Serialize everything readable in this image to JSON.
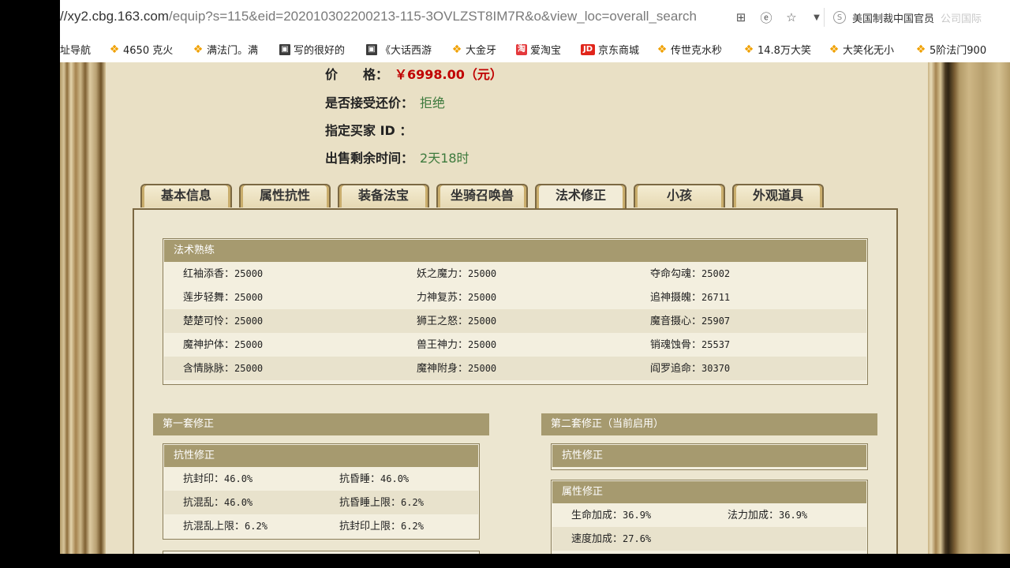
{
  "browser": {
    "url_host": "//xy2.cbg.163.com",
    "url_path": "/equip?s=115&eid=202010302200213-115-3OVLZST8IM7R&o&view_loc=overall_search",
    "icons": [
      "grid-icon",
      "ie-icon",
      "star-icon",
      "dropdown-icon"
    ],
    "search_engine_icon": "S",
    "search_text": "美国制裁中国官员",
    "search_ghost": "公司国际"
  },
  "bookmarks": [
    {
      "label": "址导航",
      "icon": "none"
    },
    {
      "label": "4650 克火",
      "icon": "star"
    },
    {
      "label": "满法门。满",
      "icon": "star"
    },
    {
      "label": "写的很好的",
      "icon": "img"
    },
    {
      "label": "《大话西游",
      "icon": "img"
    },
    {
      "label": "大金牙",
      "icon": "star"
    },
    {
      "label": "爱淘宝",
      "icon": "tao"
    },
    {
      "label": "京东商城",
      "icon": "jd"
    },
    {
      "label": "传世克水秒",
      "icon": "star"
    },
    {
      "label": "14.8万大笑",
      "icon": "star"
    },
    {
      "label": "大笑化无小",
      "icon": "star"
    },
    {
      "label": "5阶法门900",
      "icon": "star"
    }
  ],
  "info": {
    "price_label": "价　　格：",
    "price_value": "￥6998.00（元）",
    "counter_label": "是否接受还价：",
    "counter_value": "拒绝",
    "buyer_label": "指定买家 ID ：",
    "buyer_value": "",
    "time_label": "出售剩余时间：",
    "time_value": "2天18时"
  },
  "tabs": [
    "基本信息",
    "属性抗性",
    "装备法宝",
    "坐骑召唤兽",
    "法术修正",
    "小孩",
    "外观道具"
  ],
  "active_tab": "法术修正",
  "skills": {
    "title": "法术熟练",
    "rows": [
      [
        {
          "name": "红袖添香：",
          "value": "25000"
        },
        {
          "name": "妖之魔力：",
          "value": "25000"
        },
        {
          "name": "夺命勾魂：",
          "value": "25002"
        }
      ],
      [
        {
          "name": "莲步轻舞：",
          "value": "25000"
        },
        {
          "name": "力神复苏：",
          "value": "25000"
        },
        {
          "name": "追神摄魄：",
          "value": "26711"
        }
      ],
      [
        {
          "name": "楚楚可怜：",
          "value": "25000"
        },
        {
          "name": "狮王之怒：",
          "value": "25000"
        },
        {
          "name": "魔音摄心：",
          "value": "25907"
        }
      ],
      [
        {
          "name": "魔神护体：",
          "value": "25000"
        },
        {
          "name": "兽王神力：",
          "value": "25000"
        },
        {
          "name": "销魂蚀骨：",
          "value": "25537"
        }
      ],
      [
        {
          "name": "含情脉脉：",
          "value": "25000"
        },
        {
          "name": "魔神附身：",
          "value": "25000"
        },
        {
          "name": "阎罗追命：",
          "value": "30370"
        }
      ]
    ]
  },
  "set1": {
    "title": "第一套修正",
    "resist_title": "抗性修正",
    "resist_rows": [
      [
        {
          "name": "抗封印：",
          "value": "46.0%"
        },
        {
          "name": "抗昏睡：",
          "value": "46.0%"
        }
      ],
      [
        {
          "name": "抗混乱：",
          "value": "46.0%"
        },
        {
          "name": "抗昏睡上限：",
          "value": "6.2%"
        }
      ],
      [
        {
          "name": "抗混乱上限：",
          "value": "6.2%"
        },
        {
          "name": "抗封印上限：",
          "value": "6.2%"
        }
      ]
    ]
  },
  "set2": {
    "title": "第二套修正（当前启用）",
    "resist_title": "抗性修正",
    "attr_title": "属性修正",
    "attr_rows": [
      [
        {
          "name": "生命加成：",
          "value": "36.9%"
        },
        {
          "name": "法力加成：",
          "value": "36.9%"
        }
      ],
      [
        {
          "name": "速度加成：",
          "value": "27.6%"
        },
        {
          "name": "",
          "value": ""
        }
      ]
    ]
  }
}
